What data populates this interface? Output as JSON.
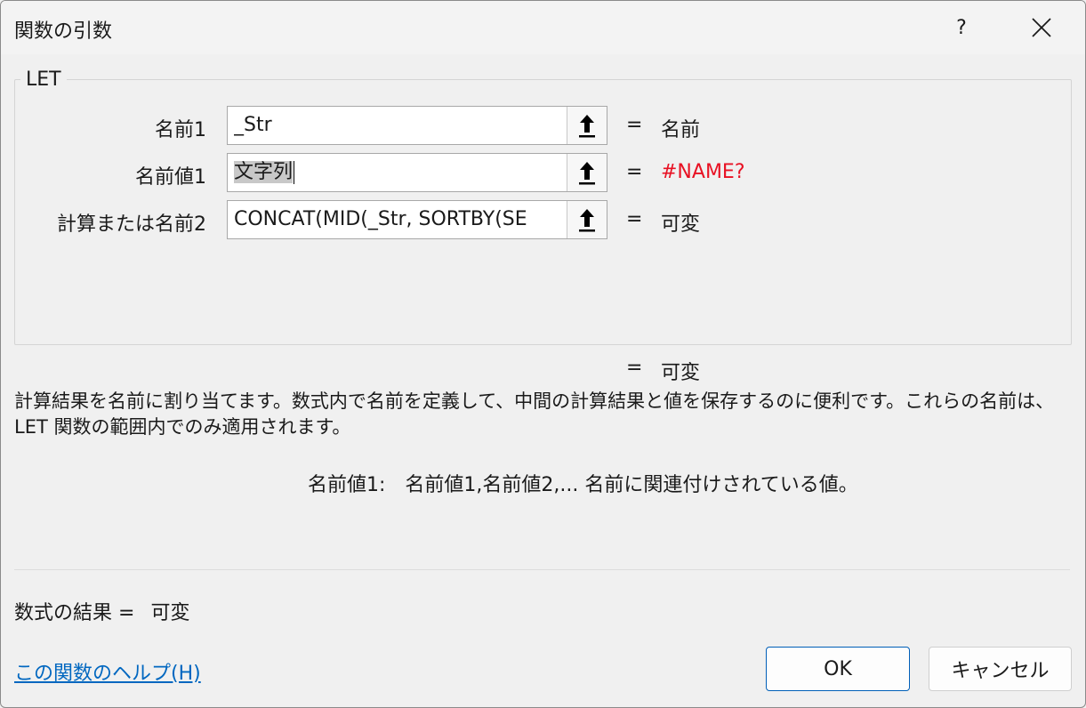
{
  "window": {
    "title": "関数の引数",
    "help_label": "?"
  },
  "function_group": {
    "name": "LET",
    "arguments": [
      {
        "label": "名前1",
        "input": "_Str",
        "equals": "=",
        "value": "名前",
        "value_color": "#1a1a1a"
      },
      {
        "label": "名前値1",
        "input": "文字列",
        "equals": "=",
        "value": "#NAME?",
        "value_color": "#e81123"
      },
      {
        "label": "計算または名前2",
        "input": "CONCAT(MID(_Str, SORTBY(SE",
        "equals": "=",
        "value": "可変",
        "value_color": "#1a1a1a"
      }
    ]
  },
  "formula_result_preview": {
    "equals": "=",
    "value": "可変"
  },
  "description": "計算結果を名前に割り当てます。数式内で名前を定義して、中間の計算結果と値を保存するのに便利です。これらの名前は、LET 関数の範囲内でのみ適用されます。",
  "argument_help": {
    "name": "名前値1:",
    "text": "名前値1,名前値2,... 名前に関連付けされている値。"
  },
  "result": {
    "label": "数式の結果 =",
    "value": "可変"
  },
  "help_link": "この関数のヘルプ(H)",
  "buttons": {
    "ok": "OK",
    "cancel": "キャンセル"
  },
  "icons": {
    "collapse": "arrow-up-icon",
    "close": "close-icon"
  },
  "colors": {
    "accent": "#005fb8",
    "link": "#0067c0",
    "error": "#e81123"
  }
}
